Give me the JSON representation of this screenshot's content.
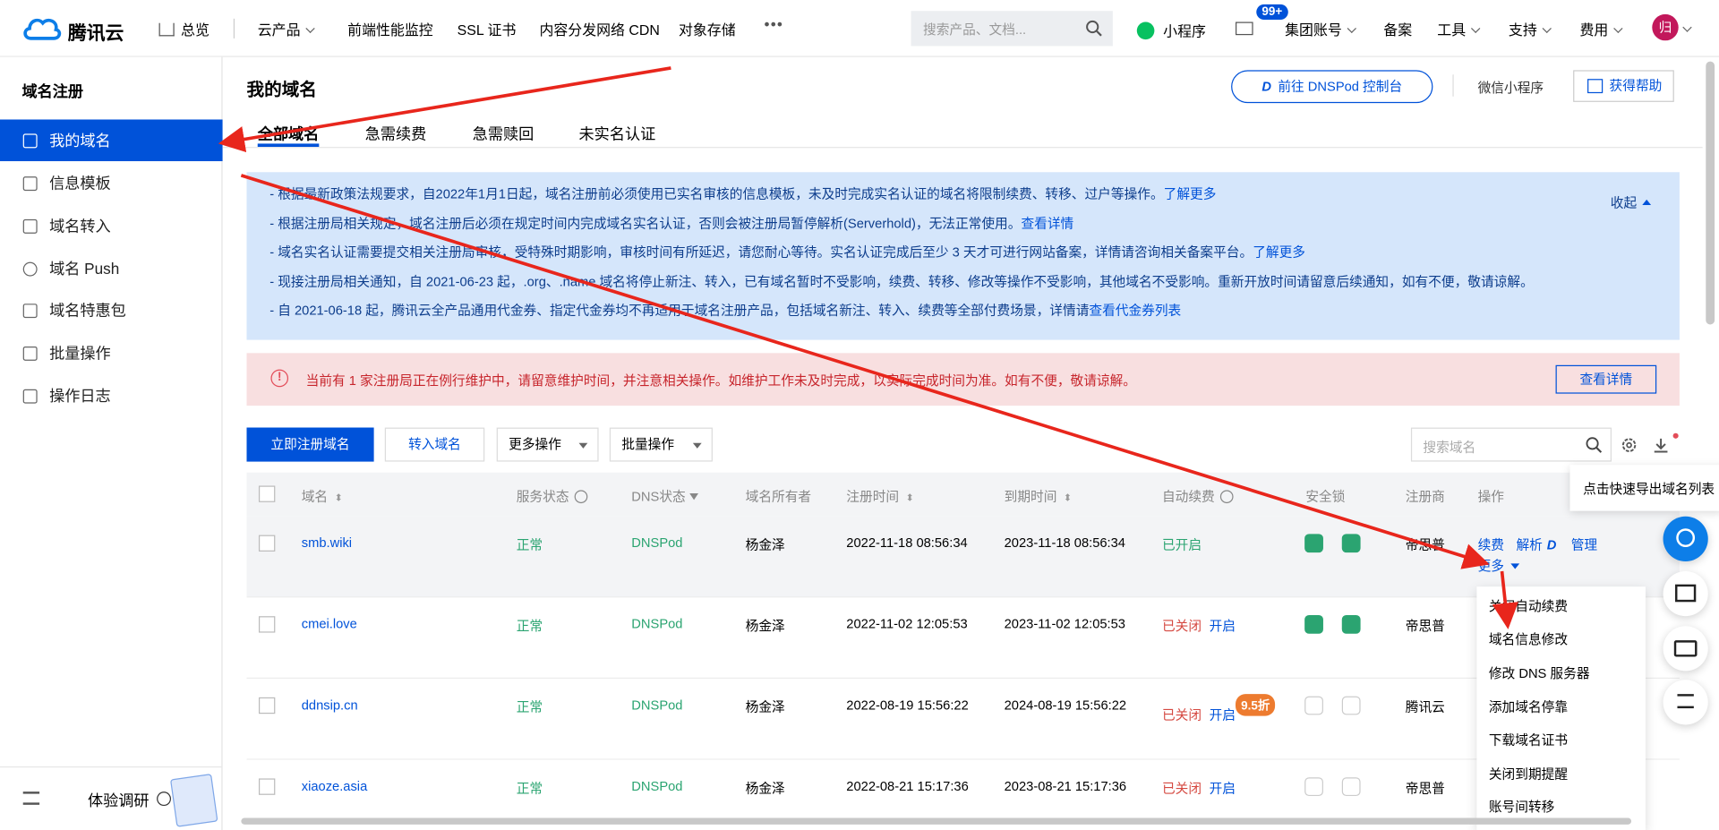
{
  "topbar": {
    "brand": "腾讯云",
    "nav": [
      "总览",
      "云产品",
      "前端性能监控",
      "SSL 证书",
      "内容分发网络 CDN",
      "对象存储"
    ],
    "more": "•••",
    "search_placeholder": "搜索产品、文档...",
    "mini_program": "小程序",
    "mail_badge": "99+",
    "account": "集团账号",
    "beian": "备案",
    "tools": "工具",
    "support": "支持",
    "fee": "费用",
    "avatar": "归"
  },
  "sidebar": {
    "title": "域名注册",
    "items": [
      {
        "label": "我的域名",
        "active": true
      },
      {
        "label": "信息模板"
      },
      {
        "label": "域名转入"
      },
      {
        "label": "域名 Push"
      },
      {
        "label": "域名特惠包"
      },
      {
        "label": "批量操作"
      },
      {
        "label": "操作日志"
      }
    ],
    "survey": "体验调研"
  },
  "header": {
    "title": "我的域名",
    "dnspod_button": "前往 DNSPod 控制台",
    "wechat": "微信小程序",
    "help": "获得帮助"
  },
  "tabs": [
    "全部域名",
    "急需续费",
    "急需赎回",
    "未实名认证"
  ],
  "notice": {
    "collapse": "收起",
    "lines": [
      {
        "text": "- 根据最新政策法规要求，自2022年1月1日起，域名注册前必须使用已实名审核的信息模板，未及时完成实名认证的域名将限制续费、转移、过户等操作。",
        "link": "了解更多"
      },
      {
        "text": "- 根据注册局相关规定，域名注册后必须在规定时间内完成域名实名认证，否则会被注册局暂停解析(Serverhold)，无法正常使用。",
        "link": "查看详情"
      },
      {
        "text": "- 域名实名认证需要提交相关注册局审核，受特殊时期影响，审核时间有所延迟，请您耐心等待。实名认证完成后至少 3 天才可进行网站备案，详情请咨询相关备案平台。",
        "link": "了解更多"
      },
      {
        "text": "- 现接注册局相关通知，自 2021-06-23 起，.org、.name 域名将停止新注、转入，已有域名暂时不受影响，续费、转移、修改等操作不受影响，其他域名不受影响。重新开放时间请留意后续通知，如有不便，敬请谅解。",
        "link": ""
      },
      {
        "text": "- 自 2021-06-18 起，腾讯云全产品通用代金券、指定代金券均不再适用于域名注册产品，包括域名新注、转入、续费等全部付费场景，详情请",
        "link": "查看代金券列表"
      }
    ]
  },
  "warning": {
    "text": "当前有 1 家注册局正在例行维护中，请留意维护时间，并注意相关操作。如维护工作未及时完成，以实际完成时间为准。如有不便，敬请谅解。",
    "button": "查看详情"
  },
  "toolbar": {
    "register": "立即注册域名",
    "transfer": "转入域名",
    "more_ops": "更多操作",
    "batch_ops": "批量操作",
    "search_placeholder": "搜索域名"
  },
  "tooltip": "点击快速导出域名列表",
  "table": {
    "headers": [
      "域名",
      "服务状态",
      "DNS状态",
      "域名所有者",
      "注册时间",
      "到期时间",
      "自动续费",
      "安全锁",
      "注册商",
      "操作"
    ],
    "rows": [
      {
        "domain": "smb.wiki",
        "status": "正常",
        "dns": "DNSPod",
        "owner": "杨金泽",
        "reg": "2022-11-18 08:56:34",
        "exp": "2023-11-18 08:56:34",
        "auto": "已开启",
        "auto_action": "",
        "discount": "",
        "locks": [
          true,
          true
        ],
        "registrar": "帝思普"
      },
      {
        "domain": "cmei.love",
        "status": "正常",
        "dns": "DNSPod",
        "owner": "杨金泽",
        "reg": "2022-11-02 12:05:53",
        "exp": "2023-11-02 12:05:53",
        "auto": "已关闭",
        "auto_action": "开启",
        "discount": "",
        "locks": [
          true,
          true
        ],
        "registrar": "帝思普"
      },
      {
        "domain": "ddnsip.cn",
        "status": "正常",
        "dns": "DNSPod",
        "owner": "杨金泽",
        "reg": "2022-08-19 15:56:22",
        "exp": "2024-08-19 15:56:22",
        "auto": "已关闭",
        "auto_action": "开启",
        "discount": "9.5折",
        "locks": [
          false,
          false
        ],
        "registrar": "腾讯云"
      },
      {
        "domain": "xiaoze.asia",
        "status": "正常",
        "dns": "DNSPod",
        "owner": "杨金泽",
        "reg": "2022-08-21 15:17:36",
        "exp": "2023-08-21 15:17:36",
        "auto": "已关闭",
        "auto_action": "开启",
        "discount": "",
        "locks": [
          false,
          false
        ],
        "registrar": "帝思普"
      }
    ],
    "ops": {
      "renew": "续费",
      "resolve": "解析",
      "manage": "管理",
      "more": "更多"
    }
  },
  "more_menu": [
    "关闭自动续费",
    "域名信息修改",
    "修改 DNS 服务器",
    "添加域名停靠",
    "下载域名证书",
    "关闭到期提醒",
    "账号间转移"
  ],
  "colors": {
    "primary": "#0052d9",
    "annotation": "#e8261c",
    "success": "#2ba471",
    "danger": "#d54941"
  }
}
